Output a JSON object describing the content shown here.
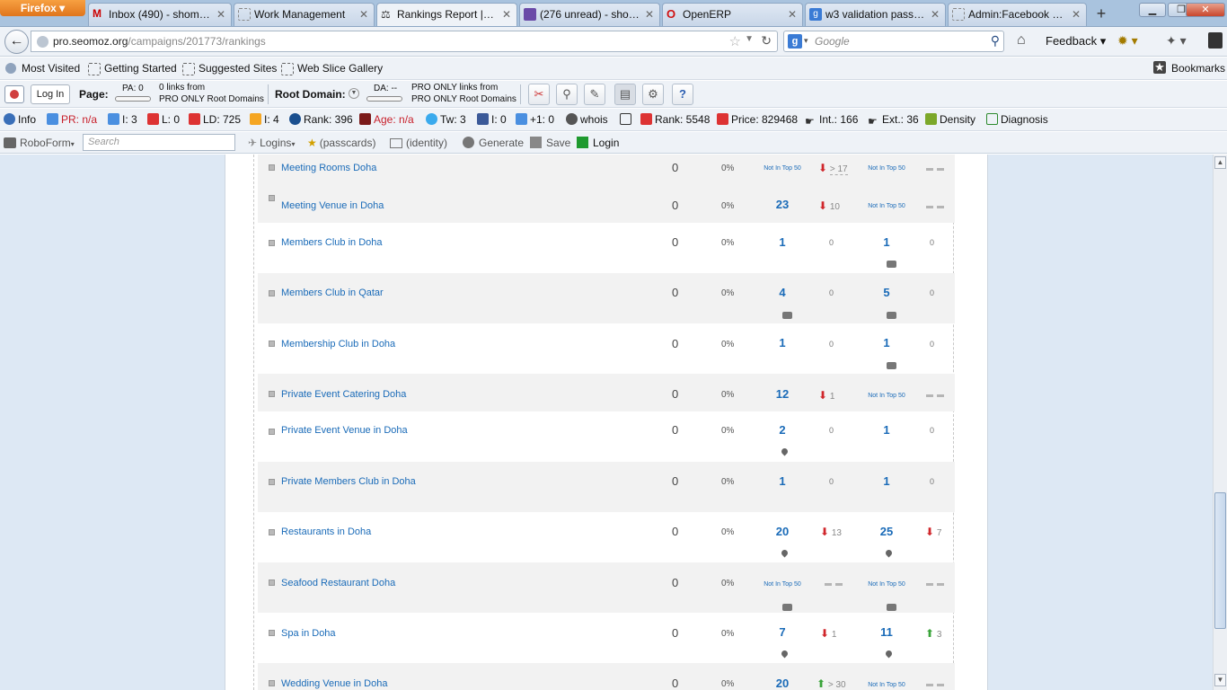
{
  "browser": {
    "app_button": "Firefox",
    "tabs": [
      {
        "label": "Inbox (490) - shome...",
        "active": false
      },
      {
        "label": "Work Management",
        "active": false
      },
      {
        "label": "Rankings Report | th...",
        "active": true
      },
      {
        "label": "(276 unread) - shom...",
        "active": false
      },
      {
        "label": "OpenERP",
        "active": false
      },
      {
        "label": "w3 validation pass - ...",
        "active": false
      },
      {
        "label": "Admin:Facebook C...",
        "active": false
      }
    ],
    "url_domain": "pro.seomoz.org",
    "url_path": "/campaigns/201773/rankings",
    "search_engine": "g",
    "search_placeholder": "Google",
    "feedback": "Feedback"
  },
  "bookmarks_bar": {
    "items": [
      "Most Visited",
      "Getting Started",
      "Suggested Sites",
      "Web Slice Gallery"
    ],
    "bookmarks": "Bookmarks"
  },
  "moz_toolbar": {
    "login": "Log In",
    "page_label": "Page:",
    "pa": "PA: 0",
    "page_links_1": "0 links from",
    "page_links_2": "PRO ONLY Root Domains",
    "root_domain_label": "Root Domain:",
    "da": "DA: --",
    "rd_links_1": "PRO ONLY links from",
    "rd_links_2": "PRO ONLY Root Domains"
  },
  "seo_toolbar": {
    "info": "Info",
    "pr": "PR: n/a",
    "i1": "I: 3",
    "l": "L: 0",
    "ld": "LD: 725",
    "i2": "I: 4",
    "rank": "Rank: 396",
    "age": "Age: n/a",
    "tw": "Tw: 3",
    "i3": "I: 0",
    "plus": "+1: 0",
    "whois": "whois",
    "rank2": "Rank: 5548",
    "price": "Price: 829468",
    "int": "Int.: 166",
    "ext": "Ext.: 36",
    "density": "Density",
    "diagnosis": "Diagnosis"
  },
  "roboform": {
    "label": "RoboForm",
    "search_placeholder": "Search",
    "logins": "Logins",
    "passcards": "(passcards)",
    "identity": "(identity)",
    "generate": "Generate",
    "save": "Save",
    "login": "Login"
  },
  "rankings": {
    "not_in_top": "Not In Top 50",
    "rows": [
      {
        "keyword": "Meeting Rooms Doha",
        "count": "0",
        "pct": "0%",
        "rank1": null,
        "ch1": "> 17",
        "ch1_dir": "down",
        "rank2": null,
        "ch2": null
      },
      {
        "keyword": "Meeting Venue in Doha",
        "count": "0",
        "pct": "0%",
        "rank1": "23",
        "ch1": "10",
        "ch1_dir": "down",
        "rank2": null,
        "ch2": null
      },
      {
        "keyword": "Members Club in Doha",
        "count": "0",
        "pct": "0%",
        "rank1": "1",
        "ch1": "0",
        "ch1_dir": "none",
        "rank2": "1",
        "ch2": "0",
        "ch2_dir": "none"
      },
      {
        "keyword": "Members Club in Qatar",
        "count": "0",
        "pct": "0%",
        "rank1": "4",
        "ch1": "0",
        "ch1_dir": "none",
        "rank2": "5",
        "ch2": "0",
        "ch2_dir": "none"
      },
      {
        "keyword": "Membership Club in Doha",
        "count": "0",
        "pct": "0%",
        "rank1": "1",
        "ch1": "0",
        "ch1_dir": "none",
        "rank2": "1",
        "ch2": "0",
        "ch2_dir": "none"
      },
      {
        "keyword": "Private Event Catering Doha",
        "count": "0",
        "pct": "0%",
        "rank1": "12",
        "ch1": "1",
        "ch1_dir": "down",
        "rank2": null,
        "ch2": null
      },
      {
        "keyword": "Private Event Venue in Doha",
        "count": "0",
        "pct": "0%",
        "rank1": "2",
        "ch1": "0",
        "ch1_dir": "none",
        "rank2": "1",
        "ch2": "0",
        "ch2_dir": "none"
      },
      {
        "keyword": "Private Members Club in Doha",
        "count": "0",
        "pct": "0%",
        "rank1": "1",
        "ch1": "0",
        "ch1_dir": "none",
        "rank2": "1",
        "ch2": "0",
        "ch2_dir": "none"
      },
      {
        "keyword": "Restaurants in Doha",
        "count": "0",
        "pct": "0%",
        "rank1": "20",
        "ch1": "13",
        "ch1_dir": "down",
        "rank2": "25",
        "ch2": "7",
        "ch2_dir": "down"
      },
      {
        "keyword": "Seafood Restaurant Doha",
        "count": "0",
        "pct": "0%",
        "rank1": null,
        "ch1": null,
        "rank2": null,
        "ch2": null
      },
      {
        "keyword": "Spa in Doha",
        "count": "0",
        "pct": "0%",
        "rank1": "7",
        "ch1": "1",
        "ch1_dir": "down",
        "rank2": "11",
        "ch2": "3",
        "ch2_dir": "up"
      },
      {
        "keyword": "Wedding Venue in Doha",
        "count": "0",
        "pct": "0%",
        "rank1": "20",
        "ch1": "> 30",
        "ch1_dir": "up",
        "rank2": null,
        "ch2": null
      }
    ]
  }
}
